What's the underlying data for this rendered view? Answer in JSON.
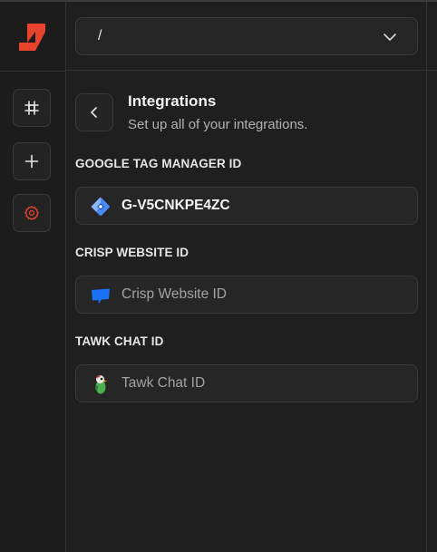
{
  "header": {
    "path_value": "/"
  },
  "page": {
    "title": "Integrations",
    "subtitle": "Set up all of your integrations."
  },
  "integrations": [
    {
      "label": "GOOGLE TAG MANAGER ID",
      "value": "G-V5CNKPE4ZC",
      "placeholder": "",
      "icon": "google-tag-manager-icon"
    },
    {
      "label": "CRISP WEBSITE ID",
      "value": "",
      "placeholder": "Crisp Website ID",
      "icon": "crisp-icon"
    },
    {
      "label": "TAWK CHAT ID",
      "value": "",
      "placeholder": "Tawk Chat ID",
      "icon": "tawk-icon"
    }
  ],
  "colors": {
    "accent": "#e8432c",
    "background": "#1f1f1f",
    "gtm_blue": "#4a8af4",
    "crisp_blue": "#1972f5"
  }
}
